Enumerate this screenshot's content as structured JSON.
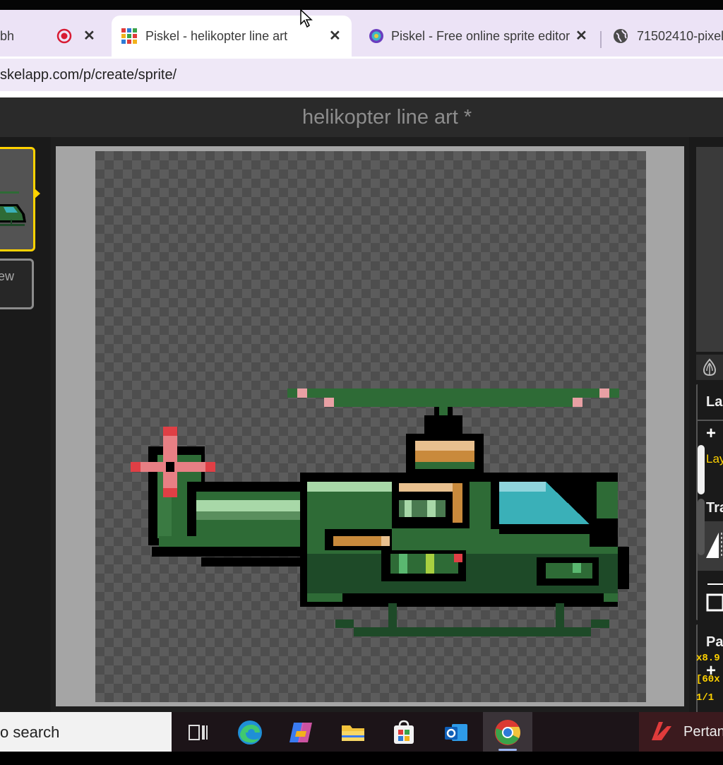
{
  "browser": {
    "tabs": [
      {
        "label": "bh",
        "active": false
      },
      {
        "label": "Piskel - helikopter line art",
        "active": true
      },
      {
        "label": "Piskel - Free online sprite editor",
        "active": false
      },
      {
        "label": "71502410-pixel-",
        "active": false
      }
    ],
    "url": "skelapp.com/p/create/sprite/"
  },
  "app": {
    "title": "helikopter line art *",
    "new_frame_label": "ew",
    "onion_icon": "onion-skin-icon",
    "layers_title": "La",
    "layers_add": "+",
    "layer_name": "Lay",
    "transform_title": "Tra",
    "palette_title": "Pa",
    "palette_add": "+",
    "zoom_readout": "x8.9",
    "size_readout": "[60x",
    "frame_readout": "1/1"
  },
  "taskbar": {
    "search_label": "o search",
    "app_label": "Pertan",
    "icons": [
      "task-view-icon",
      "edge-icon",
      "copilot-icon",
      "file-explorer-icon",
      "store-icon",
      "outlook-icon",
      "chrome-icon",
      "app-icon"
    ]
  },
  "colors": {
    "accent": "#ffd200",
    "heli_dark": "#1e4a28",
    "heli_mid": "#2e6b36",
    "heli_light": "#5a8f5e",
    "outline": "#000000",
    "window": "#3ab0b8",
    "tan": "#c98a3c",
    "pink": "#e87f84"
  }
}
